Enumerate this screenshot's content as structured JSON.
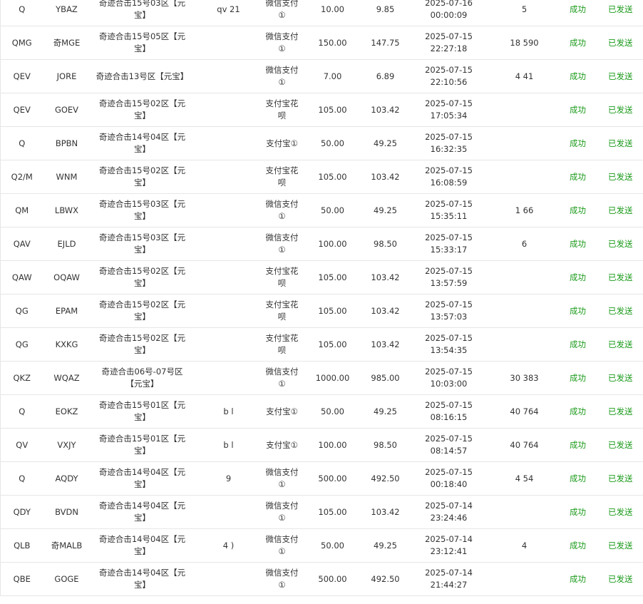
{
  "colors": {
    "success": "#1a9a1a",
    "border": "#e6e6e6",
    "text": "#333333"
  },
  "rows": [
    {
      "order_id": "Q",
      "code": "YBAZ",
      "server": "奇迹合击15号03区【元宝】",
      "account": "qv         21",
      "pay": "微信支付①",
      "amount": "10.00",
      "received": "9.85",
      "date": "2025-07-16",
      "time": "00:00:09",
      "buyer": "5",
      "status": "成功",
      "ship": "已发送"
    },
    {
      "order_id": "QMG",
      "code": "奇MGE",
      "server": "奇迹合击15号05区【元宝】",
      "account": "",
      "pay": "微信支付①",
      "amount": "150.00",
      "received": "147.75",
      "date": "2025-07-15",
      "time": "22:27:18",
      "buyer": "18   590",
      "status": "成功",
      "ship": "已发送"
    },
    {
      "order_id": "QEV",
      "code": "JORE",
      "server": "奇迹合击13号区【元宝】",
      "account": "",
      "pay": "微信支付①",
      "amount": "7.00",
      "received": "6.89",
      "date": "2025-07-15",
      "time": "22:10:56",
      "buyer": "4      41",
      "status": "成功",
      "ship": "已发送"
    },
    {
      "order_id": "QEV",
      "code": "GOEV",
      "server": "奇迹合击15号02区【元宝】",
      "account": "",
      "pay": "支付宝花呗",
      "amount": "105.00",
      "received": "103.42",
      "date": "2025-07-15",
      "time": "17:05:34",
      "buyer": "",
      "status": "成功",
      "ship": "已发送"
    },
    {
      "order_id": "Q",
      "code": "BPBN",
      "server": "奇迹合击14号04区【元宝】",
      "account": "",
      "pay": "支付宝①",
      "amount": "50.00",
      "received": "49.25",
      "date": "2025-07-15",
      "time": "16:32:35",
      "buyer": "",
      "status": "成功",
      "ship": "已发送"
    },
    {
      "order_id": "Q2/M",
      "code": "WNM",
      "server": "奇迹合击15号02区【元宝】",
      "account": "",
      "pay": "支付宝花呗",
      "amount": "105.00",
      "received": "103.42",
      "date": "2025-07-15",
      "time": "16:08:59",
      "buyer": "",
      "status": "成功",
      "ship": "已发送"
    },
    {
      "order_id": "QM",
      "code": "LBWX",
      "server": "奇迹合击15号03区【元宝】",
      "account": "",
      "pay": "微信支付①",
      "amount": "50.00",
      "received": "49.25",
      "date": "2025-07-15",
      "time": "15:35:11",
      "buyer": "1   66",
      "status": "成功",
      "ship": "已发送"
    },
    {
      "order_id": "QAV",
      "code": "EJLD",
      "server": "奇迹合击15号03区【元宝】",
      "account": "",
      "pay": "微信支付①",
      "amount": "100.00",
      "received": "98.50",
      "date": "2025-07-15",
      "time": "15:33:17",
      "buyer": "6",
      "status": "成功",
      "ship": "已发送"
    },
    {
      "order_id": "QAW",
      "code": "OQAW",
      "server": "奇迹合击15号02区【元宝】",
      "account": "",
      "pay": "支付宝花呗",
      "amount": "105.00",
      "received": "103.42",
      "date": "2025-07-15",
      "time": "13:57:59",
      "buyer": "",
      "status": "成功",
      "ship": "已发送"
    },
    {
      "order_id": "QG",
      "code": "EPAM",
      "server": "奇迹合击15号02区【元宝】",
      "account": "",
      "pay": "支付宝花呗",
      "amount": "105.00",
      "received": "103.42",
      "date": "2025-07-15",
      "time": "13:57:03",
      "buyer": "",
      "status": "成功",
      "ship": "已发送"
    },
    {
      "order_id": "QG",
      "code": "KXKG",
      "server": "奇迹合击15号02区【元宝】",
      "account": "",
      "pay": "支付宝花呗",
      "amount": "105.00",
      "received": "103.42",
      "date": "2025-07-15",
      "time": "13:54:35",
      "buyer": "",
      "status": "成功",
      "ship": "已发送"
    },
    {
      "order_id": "QKZ",
      "code": "WQAZ",
      "server": "奇迹合击06号-07号区【元宝】",
      "account": "",
      "pay": "微信支付①",
      "amount": "1000.00",
      "received": "985.00",
      "date": "2025-07-15",
      "time": "10:03:00",
      "buyer": "30   383",
      "status": "成功",
      "ship": "已发送"
    },
    {
      "order_id": "Q",
      "code": "EOKZ",
      "server": "奇迹合击15号01区【元宝】",
      "account": "b      l",
      "pay": "支付宝①",
      "amount": "50.00",
      "received": "49.25",
      "date": "2025-07-15",
      "time": "08:16:15",
      "buyer": "40   764",
      "status": "成功",
      "ship": "已发送"
    },
    {
      "order_id": "QV",
      "code": "VXJY",
      "server": "奇迹合击15号01区【元宝】",
      "account": "b      l",
      "pay": "支付宝①",
      "amount": "100.00",
      "received": "98.50",
      "date": "2025-07-15",
      "time": "08:14:57",
      "buyer": "40   764",
      "status": "成功",
      "ship": "已发送"
    },
    {
      "order_id": "Q",
      "code": "AQDY",
      "server": "奇迹合击14号04区【元宝】",
      "account": "9",
      "pay": "微信支付①",
      "amount": "500.00",
      "received": "492.50",
      "date": "2025-07-15",
      "time": "00:18:40",
      "buyer": "4     54",
      "status": "成功",
      "ship": "已发送"
    },
    {
      "order_id": "QDY",
      "code": "BVDN",
      "server": "奇迹合击14号04区【元宝】",
      "account": "",
      "pay": "微信支付①",
      "amount": "105.00",
      "received": "103.42",
      "date": "2025-07-14",
      "time": "23:24:46",
      "buyer": "",
      "status": "成功",
      "ship": "已发送"
    },
    {
      "order_id": "QLB",
      "code": "奇MALB",
      "server": "奇迹合击14号04区【元宝】",
      "account": "4     )",
      "pay": "微信支付①",
      "amount": "50.00",
      "received": "49.25",
      "date": "2025-07-14",
      "time": "23:12:41",
      "buyer": "4",
      "status": "成功",
      "ship": "已发送"
    },
    {
      "order_id": "QBE",
      "code": "GOGE",
      "server": "奇迹合击14号04区【元宝】",
      "account": "",
      "pay": "微信支付①",
      "amount": "500.00",
      "received": "492.50",
      "date": "2025-07-14",
      "time": "21:44:27",
      "buyer": "",
      "status": "成功",
      "ship": "已发送"
    }
  ]
}
